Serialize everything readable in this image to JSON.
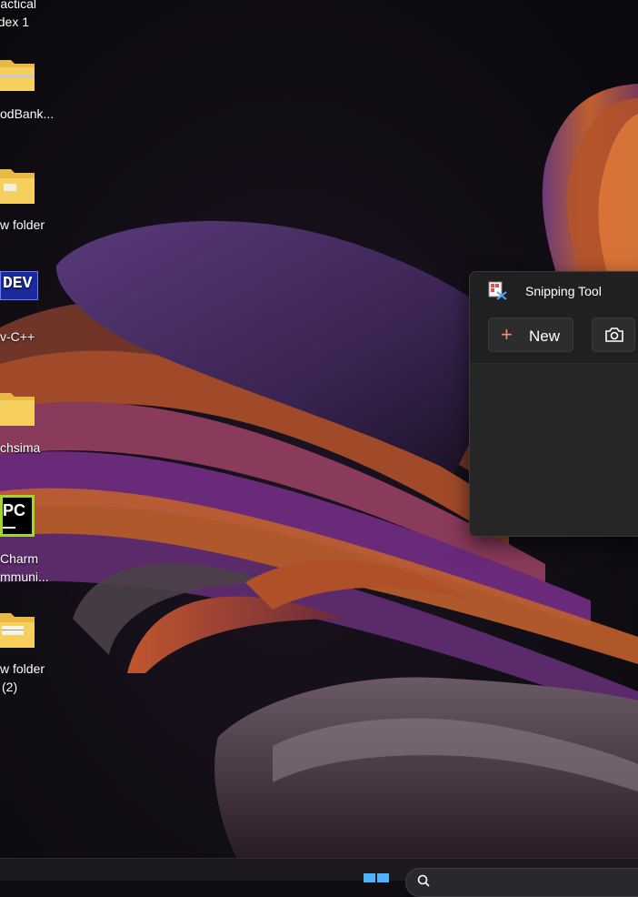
{
  "desktop": {
    "icons": [
      {
        "label_line1": "actical",
        "label_line2": "dex 1",
        "icon": "file-icon"
      },
      {
        "label_line1": "odBank...",
        "label_line2": "",
        "icon": "zip-folder-icon"
      },
      {
        "label_line1": "w folder",
        "label_line2": "",
        "icon": "folder-icon"
      },
      {
        "label_line1": "v-C++",
        "label_line2": "",
        "icon": "devcpp-icon"
      },
      {
        "label_line1": "chsima",
        "label_line2": "",
        "icon": "folder-icon"
      },
      {
        "label_line1": "Charm",
        "label_line2": "mmuni...",
        "icon": "pycharm-icon"
      },
      {
        "label_line1": "w folder",
        "label_line2": "(2)",
        "icon": "folder-icon"
      }
    ],
    "devcpp_badge": "DEV",
    "pycharm_badge": "PC"
  },
  "snipping_tool": {
    "title": "Snipping Tool",
    "new_label": "New",
    "accent_color": "#ff8a7a"
  },
  "taskbar": {
    "start_icon": "windows-logo-icon",
    "search_icon": "search-icon"
  }
}
